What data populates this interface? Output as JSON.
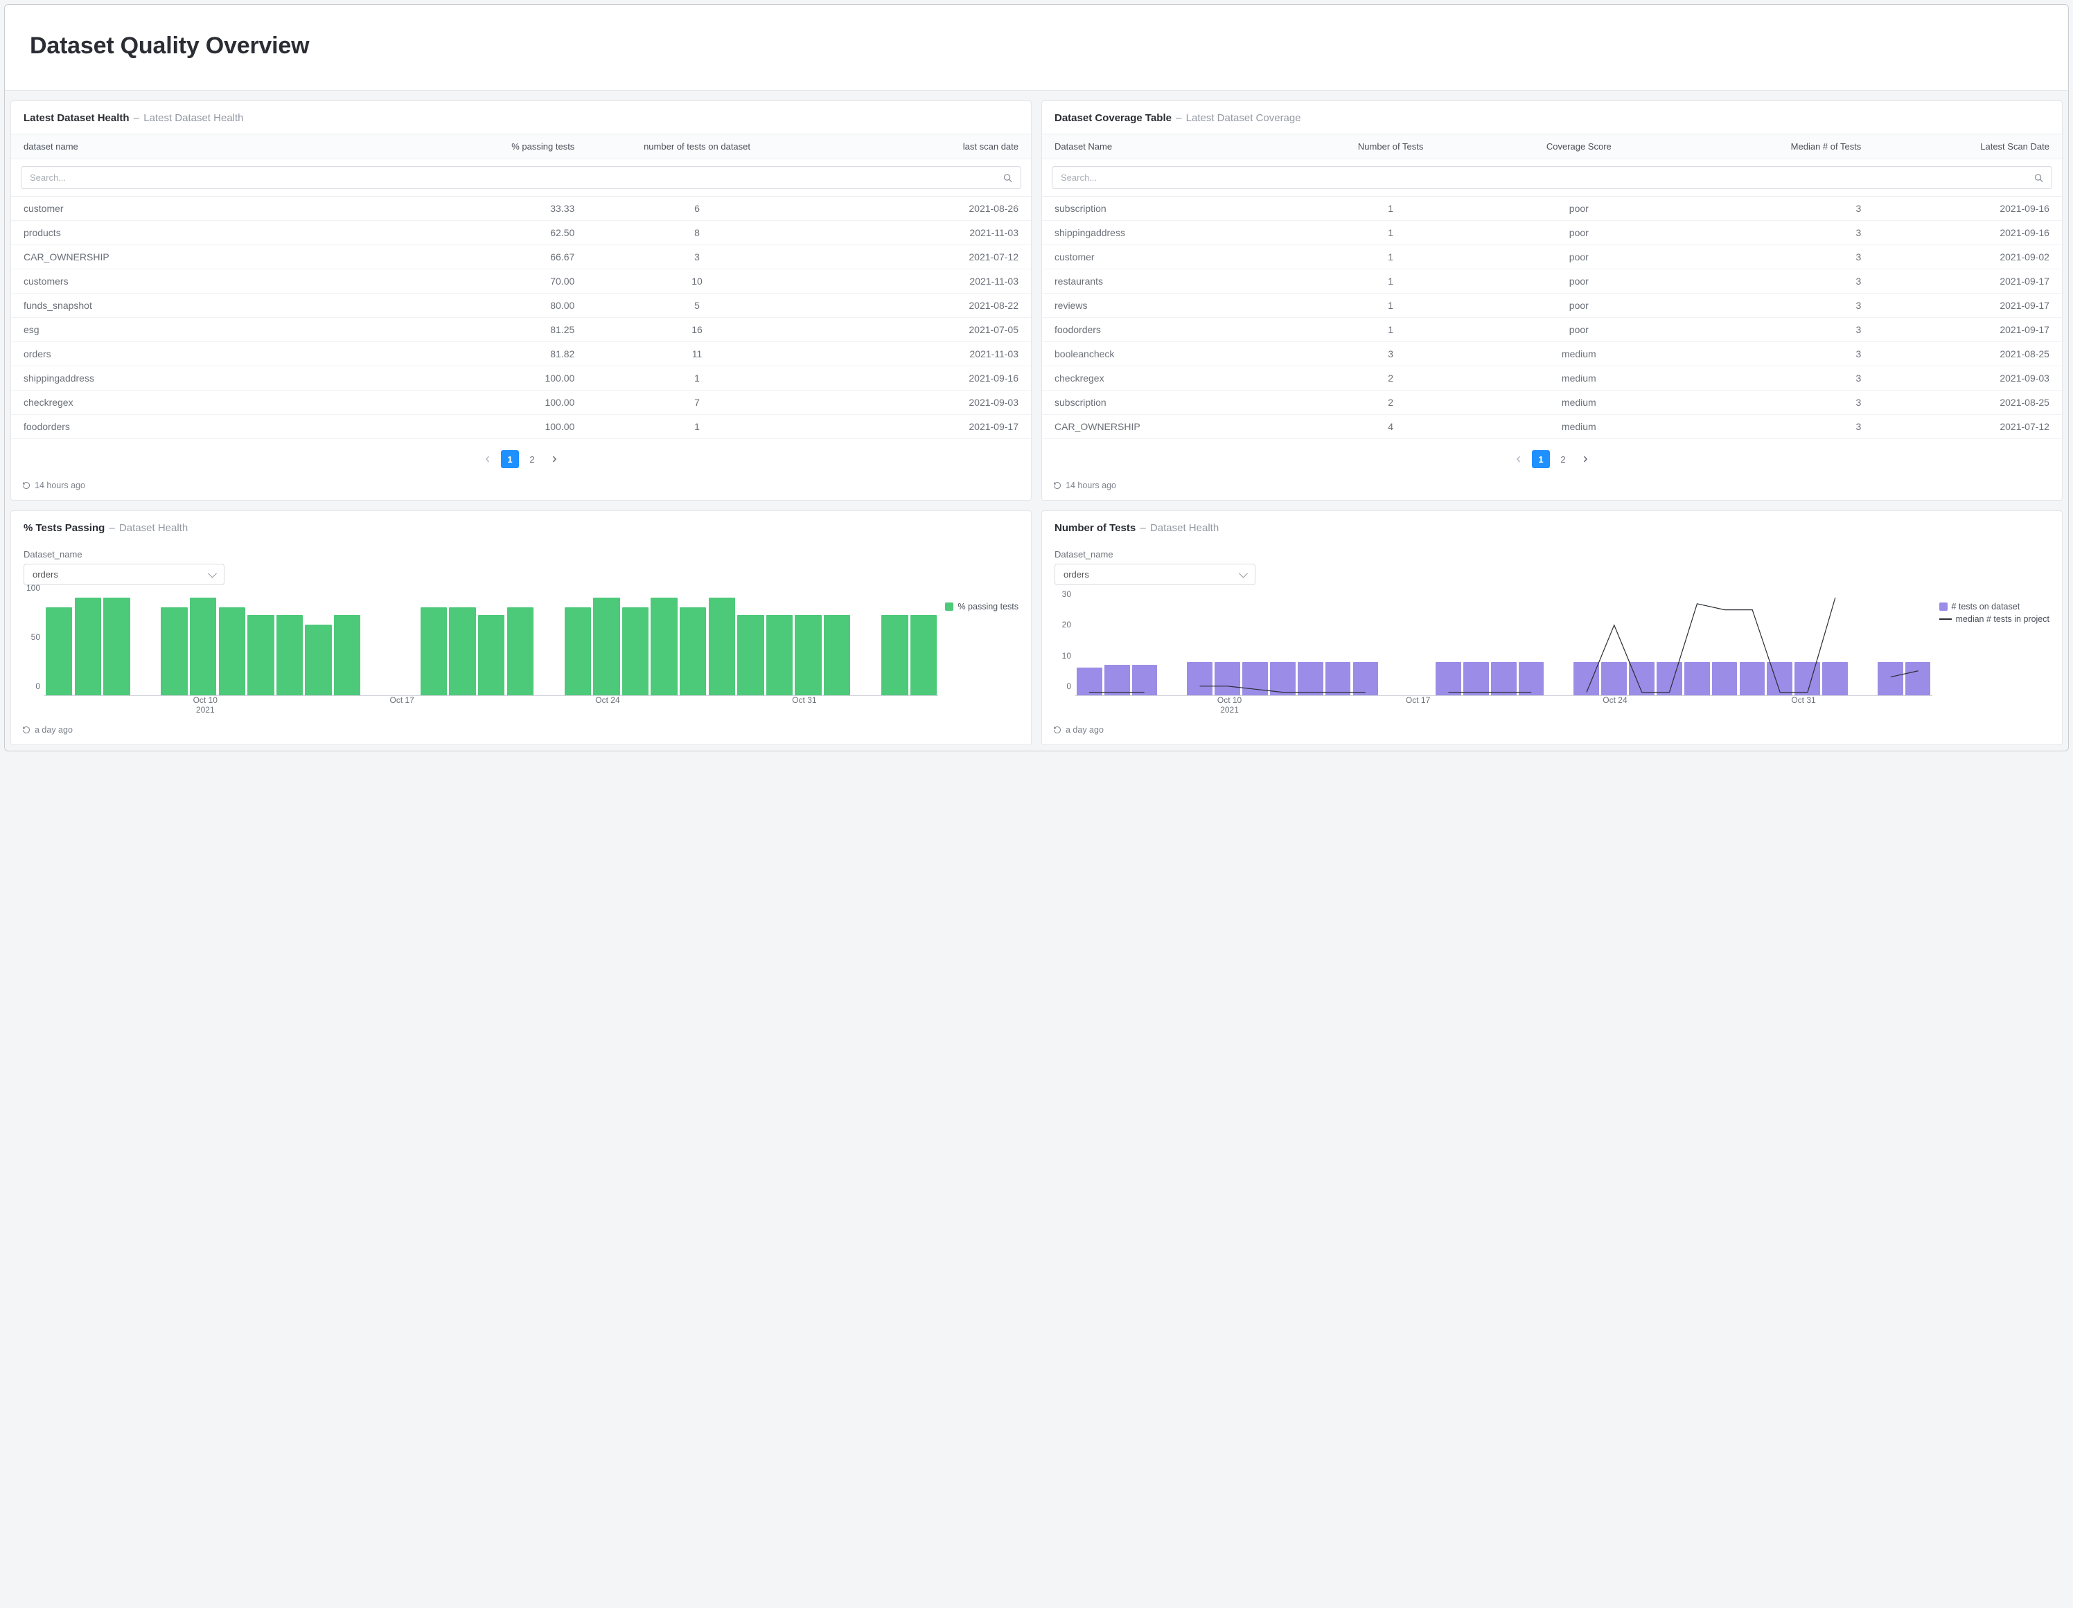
{
  "page": {
    "title": "Dataset Quality Overview"
  },
  "panels": {
    "health": {
      "title": "Latest Dataset Health",
      "subtitle": "Latest Dataset Health",
      "columns": [
        "dataset name",
        "% passing tests",
        "number of tests on dataset",
        "last scan date"
      ],
      "search_placeholder": "Search...",
      "rows": [
        {
          "name": "customer",
          "pct": "33.33",
          "n": "6",
          "date": "2021-08-26"
        },
        {
          "name": "products",
          "pct": "62.50",
          "n": "8",
          "date": "2021-11-03"
        },
        {
          "name": "CAR_OWNERSHIP",
          "pct": "66.67",
          "n": "3",
          "date": "2021-07-12"
        },
        {
          "name": "customers",
          "pct": "70.00",
          "n": "10",
          "date": "2021-11-03"
        },
        {
          "name": "funds_snapshot",
          "pct": "80.00",
          "n": "5",
          "date": "2021-08-22"
        },
        {
          "name": "esg",
          "pct": "81.25",
          "n": "16",
          "date": "2021-07-05"
        },
        {
          "name": "orders",
          "pct": "81.82",
          "n": "11",
          "date": "2021-11-03"
        },
        {
          "name": "shippingaddress",
          "pct": "100.00",
          "n": "1",
          "date": "2021-09-16"
        },
        {
          "name": "checkregex",
          "pct": "100.00",
          "n": "7",
          "date": "2021-09-03"
        },
        {
          "name": "foodorders",
          "pct": "100.00",
          "n": "1",
          "date": "2021-09-17"
        }
      ],
      "pager": {
        "pages": [
          "1",
          "2"
        ],
        "active": "1"
      },
      "updated": "14 hours ago"
    },
    "coverage": {
      "title": "Dataset Coverage Table",
      "subtitle": "Latest Dataset Coverage",
      "columns": [
        "Dataset Name",
        "Number of Tests",
        "Coverage Score",
        "Median # of Tests",
        "Latest Scan Date"
      ],
      "search_placeholder": "Search...",
      "rows": [
        {
          "name": "subscription",
          "n": "1",
          "score": "poor",
          "median": "3",
          "date": "2021-09-16"
        },
        {
          "name": "shippingaddress",
          "n": "1",
          "score": "poor",
          "median": "3",
          "date": "2021-09-16"
        },
        {
          "name": "customer",
          "n": "1",
          "score": "poor",
          "median": "3",
          "date": "2021-09-02"
        },
        {
          "name": "restaurants",
          "n": "1",
          "score": "poor",
          "median": "3",
          "date": "2021-09-17"
        },
        {
          "name": "reviews",
          "n": "1",
          "score": "poor",
          "median": "3",
          "date": "2021-09-17"
        },
        {
          "name": "foodorders",
          "n": "1",
          "score": "poor",
          "median": "3",
          "date": "2021-09-17"
        },
        {
          "name": "booleancheck",
          "n": "3",
          "score": "medium",
          "median": "3",
          "date": "2021-08-25"
        },
        {
          "name": "checkregex",
          "n": "2",
          "score": "medium",
          "median": "3",
          "date": "2021-09-03"
        },
        {
          "name": "subscription",
          "n": "2",
          "score": "medium",
          "median": "3",
          "date": "2021-08-25"
        },
        {
          "name": "CAR_OWNERSHIP",
          "n": "4",
          "score": "medium",
          "median": "3",
          "date": "2021-07-12"
        }
      ],
      "pager": {
        "pages": [
          "1",
          "2"
        ],
        "active": "1"
      },
      "updated": "14 hours ago"
    },
    "pct_chart": {
      "title": "% Tests Passing",
      "subtitle": "Dataset Health",
      "filter_label": "Dataset_name",
      "filter_value": "orders",
      "legend": {
        "series1": "% passing tests"
      },
      "updated": "a day ago"
    },
    "num_chart": {
      "title": "Number of Tests",
      "subtitle": "Dataset Health",
      "filter_label": "Dataset_name",
      "filter_value": "orders",
      "legend": {
        "series1": "# tests on dataset",
        "series2": "median # tests in project"
      },
      "updated": "a day ago"
    }
  },
  "chart_data": [
    {
      "type": "bar",
      "title": "% Tests Passing",
      "ylabel": "",
      "ylim": [
        0,
        100
      ],
      "y_ticks": [
        0,
        50,
        100
      ],
      "x_ticks": [
        "Oct 10\n2021",
        "Oct 17",
        "Oct 24",
        "Oct 31"
      ],
      "categories": [
        "Oct 05",
        "Oct 06",
        "Oct 07",
        "Oct 08",
        "Oct 09",
        "Oct 10",
        "Oct 11",
        "Oct 12",
        "Oct 13",
        "Oct 14",
        "Oct 15",
        "Oct 16",
        "Oct 17",
        "Oct 18",
        "Oct 19",
        "Oct 20",
        "Oct 21",
        "Oct 22",
        "Oct 23",
        "Oct 24",
        "Oct 25",
        "Oct 26",
        "Oct 27",
        "Oct 28",
        "Oct 29",
        "Oct 30",
        "Oct 31",
        "Nov 01",
        "Nov 02",
        "Nov 03",
        "Nov 04"
      ],
      "series": [
        {
          "name": "% passing tests",
          "values": [
            90,
            100,
            100,
            null,
            90,
            100,
            90,
            82,
            82,
            72,
            82,
            null,
            null,
            90,
            90,
            82,
            90,
            null,
            90,
            100,
            90,
            100,
            90,
            100,
            82,
            82,
            82,
            82,
            null,
            82,
            82
          ]
        }
      ]
    },
    {
      "type": "bar+line",
      "title": "Number of Tests",
      "ylabel": "",
      "ylim": [
        0,
        32
      ],
      "y_ticks": [
        0,
        10,
        20,
        30
      ],
      "x_ticks": [
        "Oct 10\n2021",
        "Oct 17",
        "Oct 24",
        "Oct 31"
      ],
      "categories": [
        "Oct 05",
        "Oct 06",
        "Oct 07",
        "Oct 08",
        "Oct 09",
        "Oct 10",
        "Oct 11",
        "Oct 12",
        "Oct 13",
        "Oct 14",
        "Oct 15",
        "Oct 16",
        "Oct 17",
        "Oct 18",
        "Oct 19",
        "Oct 20",
        "Oct 21",
        "Oct 22",
        "Oct 23",
        "Oct 24",
        "Oct 25",
        "Oct 26",
        "Oct 27",
        "Oct 28",
        "Oct 29",
        "Oct 30",
        "Oct 31",
        "Nov 01",
        "Nov 02",
        "Nov 03",
        "Nov 04"
      ],
      "series": [
        {
          "name": "# tests on dataset",
          "style": "bar",
          "values": [
            9,
            10,
            10,
            null,
            11,
            11,
            11,
            11,
            11,
            11,
            11,
            null,
            null,
            11,
            11,
            11,
            11,
            null,
            11,
            11,
            11,
            11,
            11,
            11,
            11,
            11,
            11,
            11,
            null,
            11,
            11
          ]
        },
        {
          "name": "median # tests in project",
          "style": "line",
          "values": [
            1,
            1,
            1,
            null,
            3,
            3,
            2,
            1,
            1,
            1,
            1,
            null,
            null,
            1,
            1,
            1,
            1,
            null,
            1,
            23,
            1,
            1,
            30,
            28,
            28,
            1,
            1,
            32,
            null,
            6,
            8
          ]
        }
      ]
    }
  ]
}
